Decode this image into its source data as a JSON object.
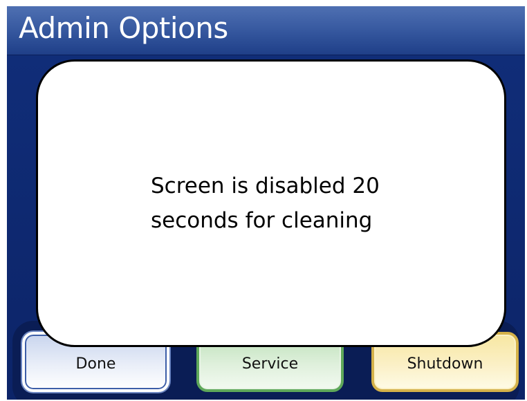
{
  "header": {
    "title": "Admin Options"
  },
  "modal": {
    "message": "Screen is disabled 20\nseconds for cleaning"
  },
  "buttons": [
    {
      "label": "Done",
      "color": "#dbe4f5"
    },
    {
      "label": "Service",
      "color": "#cfe9cb"
    },
    {
      "label": "Shutdown",
      "color": "#f9ebb3"
    }
  ],
  "colors": {
    "background": "#0e2a73",
    "header": "#3759a0",
    "modal_background": "#ffffff",
    "modal_border": "#000000"
  }
}
